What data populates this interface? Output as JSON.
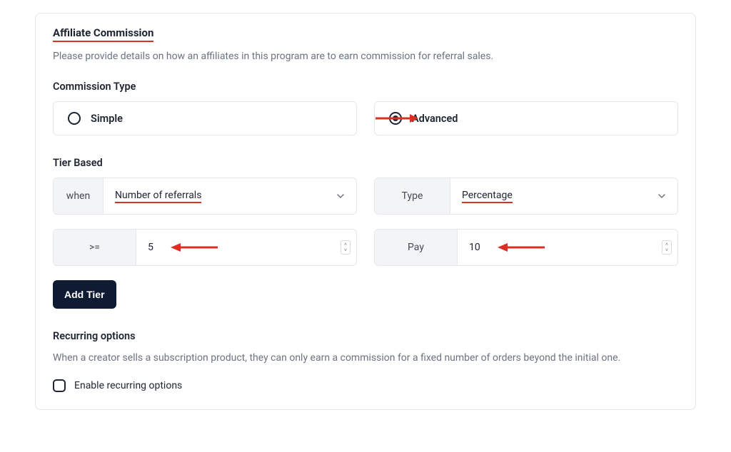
{
  "section": {
    "title": "Affiliate Commission",
    "description": "Please provide details on how an affiliates in this program are to earn commission for referral sales."
  },
  "commissionType": {
    "label": "Commission Type",
    "options": [
      {
        "label": "Simple",
        "selected": false
      },
      {
        "label": "Advanced",
        "selected": true
      }
    ]
  },
  "tierBased": {
    "label": "Tier Based",
    "whenPrefix": "when",
    "whenValue": "Number of referrals",
    "typePrefix": "Type",
    "typeValue": "Percentage",
    "gtePrefix": ">=",
    "gteValue": "5",
    "payPrefix": "Pay",
    "payValue": "10"
  },
  "addTier": "Add Tier",
  "recurring": {
    "label": "Recurring options",
    "description": "When a creator sells a subscription product, they can only earn a commission for a fixed number of orders beyond the initial one.",
    "checkboxLabel": "Enable recurring options"
  },
  "annotation": {
    "arrowColor": "#d93025"
  }
}
